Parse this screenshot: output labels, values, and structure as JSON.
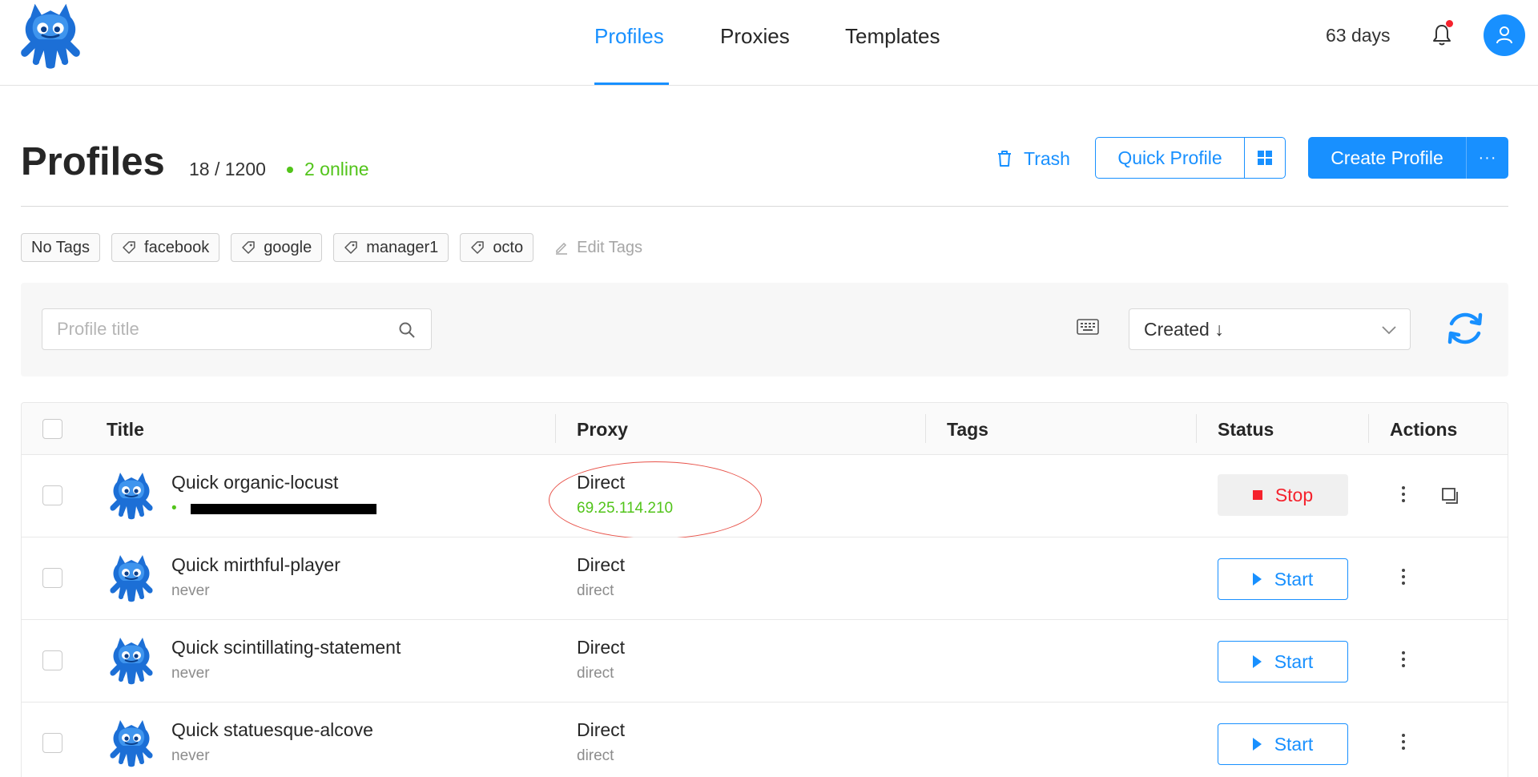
{
  "nav": {
    "tabs": [
      {
        "label": "Profiles",
        "active": true
      },
      {
        "label": "Proxies",
        "active": false
      },
      {
        "label": "Templates",
        "active": false
      }
    ],
    "subscription_days": "63 days",
    "notification_icon": "bell-icon",
    "user_icon": "user-icon"
  },
  "header": {
    "title": "Profiles",
    "count": "18 / 1200",
    "online": "2 online",
    "trash_label": "Trash",
    "quick_profile_label": "Quick Profile",
    "create_profile_label": "Create Profile",
    "create_more_label": "···"
  },
  "tags": {
    "items": [
      "No Tags",
      "facebook",
      "google",
      "manager1",
      "octo"
    ],
    "edit_label": "Edit Tags"
  },
  "filters": {
    "search_placeholder": "Profile title",
    "sort_label": "Created ↓"
  },
  "table": {
    "columns": [
      "Title",
      "Proxy",
      "Tags",
      "Status",
      "Actions"
    ],
    "rows": [
      {
        "title": "Quick organic-locust",
        "subtitle": "•",
        "proxy": "Direct",
        "proxy_detail": "69.25.114.210",
        "status": "Stop",
        "running": true
      },
      {
        "title": "Quick mirthful-player",
        "subtitle": "never",
        "proxy": "Direct",
        "proxy_detail": "direct",
        "status": "Start",
        "running": false
      },
      {
        "title": "Quick scintillating-statement",
        "subtitle": "never",
        "proxy": "Direct",
        "proxy_detail": "direct",
        "status": "Start",
        "running": false
      },
      {
        "title": "Quick statuesque-alcove",
        "subtitle": "never",
        "proxy": "Direct",
        "proxy_detail": "direct",
        "status": "Start",
        "running": false
      }
    ]
  },
  "colors": {
    "accent": "#1890ff",
    "online": "#52c41a",
    "stop": "#f5222d",
    "annotation": "#e8534a"
  }
}
